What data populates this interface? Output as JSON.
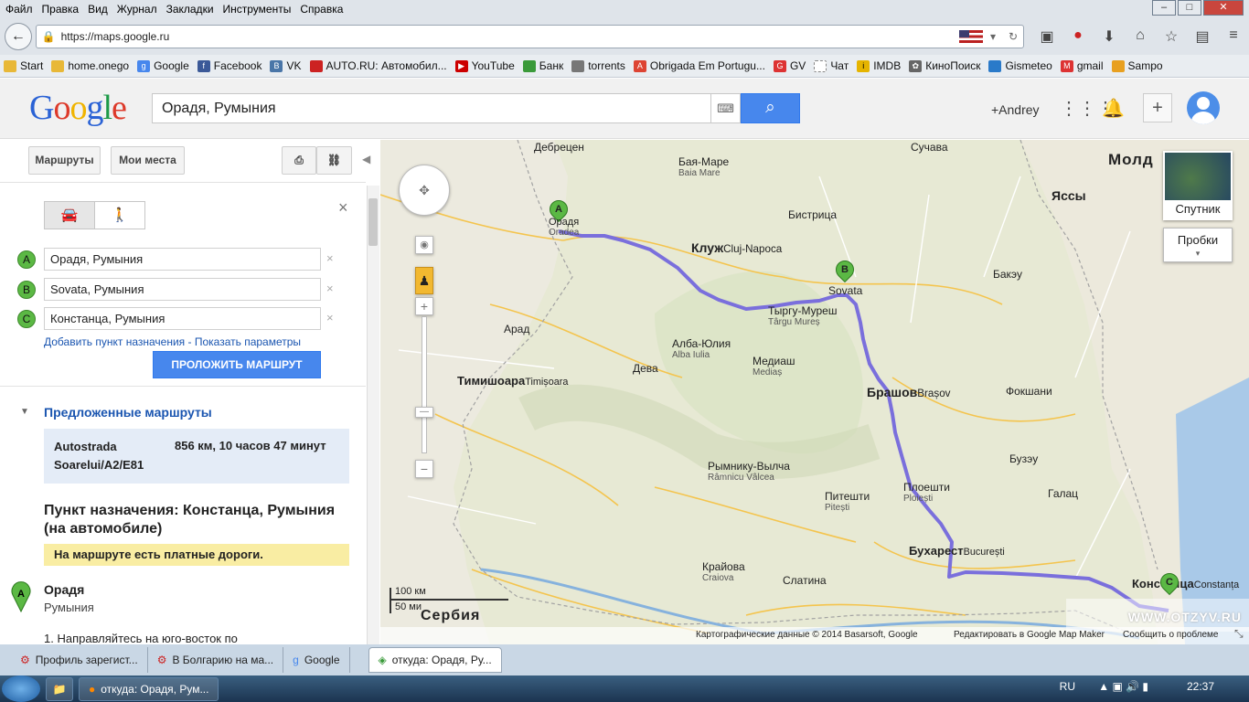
{
  "menu": [
    "Файл",
    "Правка",
    "Вид",
    "Журнал",
    "Закладки",
    "Инструменты",
    "Справка"
  ],
  "url": "https://maps.google.ru",
  "bookmarks": [
    "Start",
    "home.onego",
    "Google",
    "Facebook",
    "VK",
    "AUTO.RU: Автомобил...",
    "YouTube",
    "Банк",
    "torrents",
    "Obrigada Em Portugu...",
    "GV",
    "Чат",
    "IMDB",
    "КиноПоиск",
    "Gismeteo",
    "gmail",
    "Sampo"
  ],
  "search": {
    "value": "Орадя, Румыния"
  },
  "user": "+Andrey",
  "panel": {
    "routes_btn": "Маршруты",
    "myplaces_btn": "Мои места",
    "waypoints": [
      {
        "letter": "A",
        "value": "Орадя, Румыния"
      },
      {
        "letter": "B",
        "value": "Sovata, Румыния"
      },
      {
        "letter": "C",
        "value": "Констанца, Румыния"
      }
    ],
    "add_dest": "Добавить пункт назначения",
    "show_params": "Показать параметры",
    "route_btn": "ПРОЛОЖИТЬ МАРШРУТ",
    "suggested": "Предложенные маршруты",
    "route_name": "Autostrada Soarelui/A2/E81",
    "route_info": "856 км, 10 часов 47 минут",
    "dest_title": "Пункт назначения: Констанца, Румыния (на автомобиле)",
    "toll_warning": "На маршруте есть платные дороги.",
    "start_city": "Орадя",
    "start_country": "Румыния",
    "step1": "1. Направляйтесь на юго-восток по"
  },
  "map": {
    "layer_satellite": "Спутник",
    "layer_traffic": "Пробки",
    "scale_km": "100 км",
    "scale_mi": "50 ми",
    "attribution": "Картографические данные © 2014 Basarsoft, Google",
    "edit_link": "Редактировать в Google Map Maker",
    "report": "Сообщить о проблеме",
    "watermark": "WWW.OTZYV.RU",
    "cities": {
      "oradea": "Орадя",
      "oradea_lat": "Oradea",
      "cluj": "Клуж",
      "cluj_lat": "Cluj-Napoca",
      "sovata": "Sovata",
      "brasov": "Брашов",
      "brasov_lat": "Brașov",
      "bucharest": "Бухарест",
      "bucharest_lat": "București",
      "constanta": "Констанца",
      "constanta_lat": "Constanța",
      "timisoara": "Тимишоара",
      "timisoara_lat": "Timișoara",
      "ploiesti": "Плоешти",
      "ploiesti_lat": "Ploiești",
      "pitesti": "Питешти",
      "pitesti_lat": "Pitești",
      "craiova": "Крайова",
      "craiova_lat": "Craiova",
      "targu": "Тыргу-Муреш",
      "targu_lat": "Târgu Mureș",
      "alba": "Алба-Юлия",
      "alba_lat": "Alba Iulia",
      "sibiu": "Медиаш",
      "sibiu_lat": "Mediaș",
      "baia": "Бая-Маре",
      "baia_lat": "Baia Mare",
      "debrecen": "Дебрецен",
      "bistrita": "Бистрица",
      "suceava": "Сучава",
      "iasi": "Яссы",
      "bacau": "Бакэу",
      "galati": "Галац",
      "slatina": "Слатина",
      "ramnicu": "Рымнику-Вылча",
      "ramnicu_lat": "Râmnicu Vâlcea",
      "serbia": "Сербия",
      "moldova": "Молд",
      "arad": "Арад",
      "deva": "Дева",
      "focsani": "Фокшани",
      "buzau": "Бузэу"
    }
  },
  "tabs": [
    "Профиль зарегист...",
    "В Болгарию на ма...",
    "Google",
    "откуда: Орадя, Ру..."
  ],
  "task": "откуда: Орадя, Рум...",
  "tray": {
    "lang": "RU",
    "time": "22:37"
  },
  "colors": {
    "route": "#7a6fdc",
    "accent": "#4787ed",
    "marker": "#5bb844"
  }
}
